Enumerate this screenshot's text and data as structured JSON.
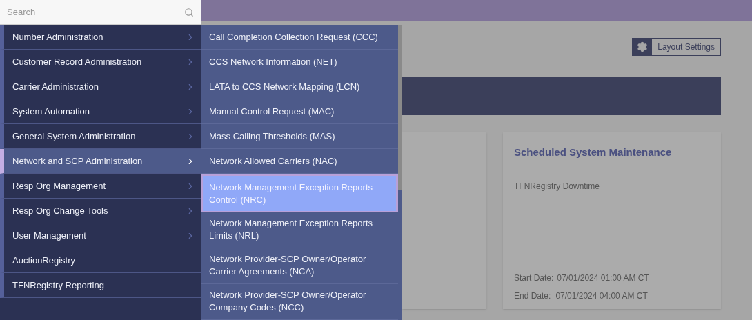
{
  "search": {
    "placeholder": "Search"
  },
  "menu": [
    {
      "label": "Number Administration",
      "has_submenu": true,
      "selected": false
    },
    {
      "label": "Customer Record Administration",
      "has_submenu": true,
      "selected": false
    },
    {
      "label": "Carrier Administration",
      "has_submenu": true,
      "selected": false
    },
    {
      "label": "System Automation",
      "has_submenu": true,
      "selected": false
    },
    {
      "label": "General System Administration",
      "has_submenu": true,
      "selected": false
    },
    {
      "label": "Network and SCP Administration",
      "has_submenu": true,
      "selected": true
    },
    {
      "label": "Resp Org Management",
      "has_submenu": true,
      "selected": false
    },
    {
      "label": "Resp Org Change Tools",
      "has_submenu": true,
      "selected": false
    },
    {
      "label": "User Management",
      "has_submenu": true,
      "selected": false
    },
    {
      "label": "AuctionRegistry",
      "has_submenu": false,
      "selected": false
    },
    {
      "label": "TFNRegistry Reporting",
      "has_submenu": false,
      "selected": false
    }
  ],
  "submenu": [
    {
      "label": "Call Completion Collection Request (CCC)",
      "selected": false
    },
    {
      "label": "CCS Network Information (NET)",
      "selected": false
    },
    {
      "label": "LATA to CCS Network Mapping (LCN)",
      "selected": false
    },
    {
      "label": "Manual Control Request (MAC)",
      "selected": false
    },
    {
      "label": "Mass Calling Thresholds (MAS)",
      "selected": false
    },
    {
      "label": "Network Allowed Carriers (NAC)",
      "selected": false
    },
    {
      "label": "Network Management Exception Reports Control (NRC)",
      "selected": true
    },
    {
      "label": "Network Management Exception Reports Limits (NRL)",
      "selected": false
    },
    {
      "label": "Network Provider-SCP Owner/Operator Carrier Agreements (NCA)",
      "selected": false
    },
    {
      "label": "Network Provider-SCP Owner/Operator Company Codes (NCC)",
      "selected": false
    }
  ],
  "layout_settings": {
    "label": "Layout Settings"
  },
  "maintenance_card": {
    "title": "Scheduled System Maintenance",
    "description": "TFNRegistry Downtime",
    "start_label": "Start Date:",
    "start_value": "07/01/2024 01:00 AM CT",
    "end_label": "End Date:",
    "end_value": "07/01/2024 04:00 AM CT"
  }
}
